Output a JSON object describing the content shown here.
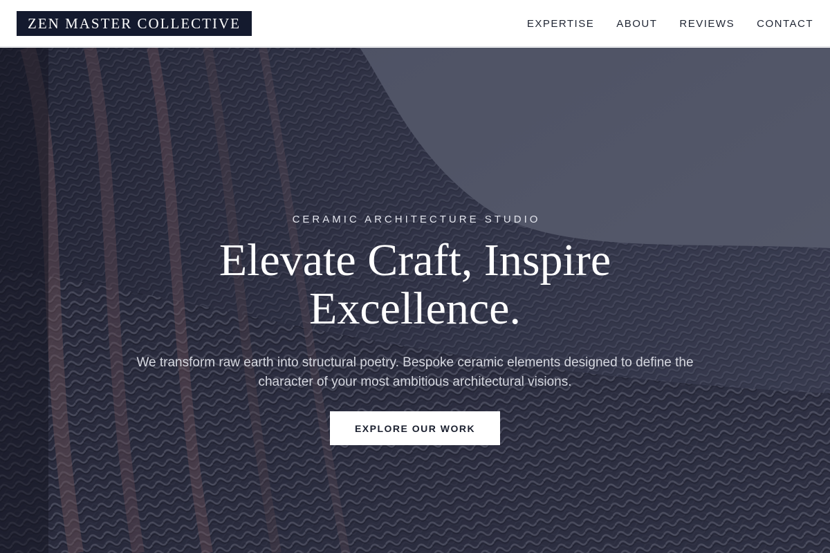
{
  "header": {
    "logo_text": "ZEN MASTER COLLECTIVE",
    "nav": [
      {
        "label": "EXPERTISE"
      },
      {
        "label": "ABOUT"
      },
      {
        "label": "REVIEWS"
      },
      {
        "label": "CONTACT"
      }
    ]
  },
  "hero": {
    "eyebrow": "CERAMIC ARCHITECTURE STUDIO",
    "headline": "Elevate Craft, Inspire Excellence.",
    "subtext": "We transform raw earth into structural poetry. Bespoke ceramic elements designed to define the character of your most ambitious architectural visions.",
    "cta_label": "EXPLORE OUR WORK",
    "background_image": "woven-ceramic-facade-photo"
  },
  "colors": {
    "logo_background": "#141a2e",
    "nav_text": "#1f2533",
    "hero_text": "#ffffff",
    "cta_background": "#ffffff",
    "cta_text": "#1a1f2e"
  }
}
